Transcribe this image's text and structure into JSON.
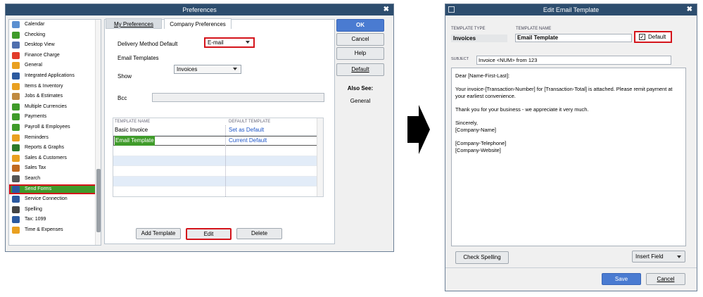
{
  "preferences": {
    "title": "Preferences",
    "close": "✖",
    "sidebar_items": [
      {
        "label": "Calendar",
        "color": "#5b8fd0"
      },
      {
        "label": "Checking",
        "color": "#3f9b2a"
      },
      {
        "label": "Desktop View",
        "color": "#4f6fae"
      },
      {
        "label": "Finance Charge",
        "color": "#e23b2a"
      },
      {
        "label": "General",
        "color": "#e9a020"
      },
      {
        "label": "Integrated Applications",
        "color": "#2c5aa0"
      },
      {
        "label": "Items & Inventory",
        "color": "#e9a020"
      },
      {
        "label": "Jobs & Estimates",
        "color": "#c08a40"
      },
      {
        "label": "Multiple Currencies",
        "color": "#3f9b2a"
      },
      {
        "label": "Payments",
        "color": "#3f9b2a"
      },
      {
        "label": "Payroll & Employees",
        "color": "#3f9b2a"
      },
      {
        "label": "Reminders",
        "color": "#e9a020"
      },
      {
        "label": "Reports & Graphs",
        "color": "#2c7a2a"
      },
      {
        "label": "Sales & Customers",
        "color": "#e9a020"
      },
      {
        "label": "Sales Tax",
        "color": "#c06a20"
      },
      {
        "label": "Search",
        "color": "#555"
      },
      {
        "label": "Send Forms",
        "color": "#2c5aa0"
      },
      {
        "label": "Service Connection",
        "color": "#2c5aa0"
      },
      {
        "label": "Spelling",
        "color": "#444"
      },
      {
        "label": "Tax: 1099",
        "color": "#2c5aa0"
      },
      {
        "label": "Time & Expenses",
        "color": "#e9a020"
      }
    ],
    "selected_index": 16,
    "tabs": [
      "My Preferences",
      "Company Preferences"
    ],
    "delivery_label": "Delivery Method Default",
    "delivery_value": "E-mail",
    "email_templates_label": "Email Templates",
    "show_label": "Show",
    "show_value": "Invoices",
    "bcc_label": "Bcc",
    "col_template": "TEMPLATE NAME",
    "col_default": "DEFAULT TEMPLATE",
    "rows": [
      {
        "name": "Basic Invoice",
        "def": "Set as Default"
      },
      {
        "name": "Email Template",
        "def": "Current Default"
      }
    ],
    "add_template": "Add Template",
    "edit": "Edit",
    "delete": "Delete",
    "ok": "OK",
    "cancel": "Cancel",
    "help": "Help",
    "default": "Default",
    "also_see": "Also See:",
    "also_see_link": "General"
  },
  "edit_template": {
    "title": "Edit Email Template",
    "close": "✖",
    "type_label": "TEMPLATE TYPE",
    "type_value": "Invoices",
    "name_label": "TEMPLATE NAME",
    "name_value": "Email Template",
    "default_label": "Default",
    "subject_label": "SUBJECT",
    "subject_value": "Invoice <NUM> from 123",
    "body_lines": [
      "Dear [Name-First-Last]:",
      "",
      "Your invoice-[Transaction-Number] for [Transaction-Total] is attached. Please remit payment at",
      "your earliest convenience.",
      "",
      "Thank you for your business - we appreciate it very much.",
      "",
      "Sincerely,",
      "[Company-Name]",
      "",
      "[Company-Telephone]",
      "[Company-Website]"
    ],
    "check_spelling": "Check Spelling",
    "insert_field": "Insert Field",
    "save": "Save",
    "cancel": "Cancel"
  },
  "colors": {
    "titlebar": "#2d4d6e",
    "accent": "#4a7bd1",
    "selected": "#3f9b2a",
    "highlight": "#d4141b"
  }
}
